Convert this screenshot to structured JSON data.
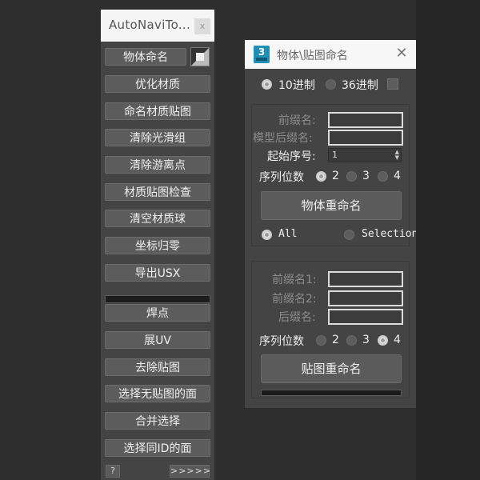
{
  "toolbox": {
    "title": "AutoNaviTo...",
    "close_label": "x",
    "buttons": [
      "物体命名",
      "优化材质",
      "命名材质贴图",
      "清除光滑组",
      "清除游离点",
      "材质贴图检查",
      "清空材质球",
      "坐标归零",
      "导出USX"
    ],
    "buttons2": [
      "焊点",
      "展UV",
      "去除贴图",
      "选择无贴图的面",
      "合并选择",
      "选择同ID的面"
    ],
    "help_label": "?",
    "more_label": ">>>>>"
  },
  "dialog": {
    "title": "物体\\贴图命名",
    "app_icon_label": "3",
    "close_label": "✕",
    "base": {
      "option1": "10进制",
      "option2": "36进制",
      "selected": "10进制"
    },
    "object_group": {
      "prefix_label": "前缀名:",
      "suffix_label": "模型后缀名:",
      "start_label": "起始序号:",
      "start_value": "1",
      "digits_label": "序列位数",
      "digits_options": [
        "2",
        "3",
        "4"
      ],
      "digits_selected": "2",
      "rename_button": "物体重命名",
      "scope_all": "All",
      "scope_selection": "Selection",
      "scope_selected": "All"
    },
    "map_group": {
      "prefix1_label": "前缀名1:",
      "prefix2_label": "前缀名2:",
      "suffix_label": "后缀名:",
      "digits_label": "序列位数",
      "digits_options": [
        "2",
        "3",
        "4"
      ],
      "digits_selected": "4",
      "rename_button": "贴图重命名"
    }
  }
}
